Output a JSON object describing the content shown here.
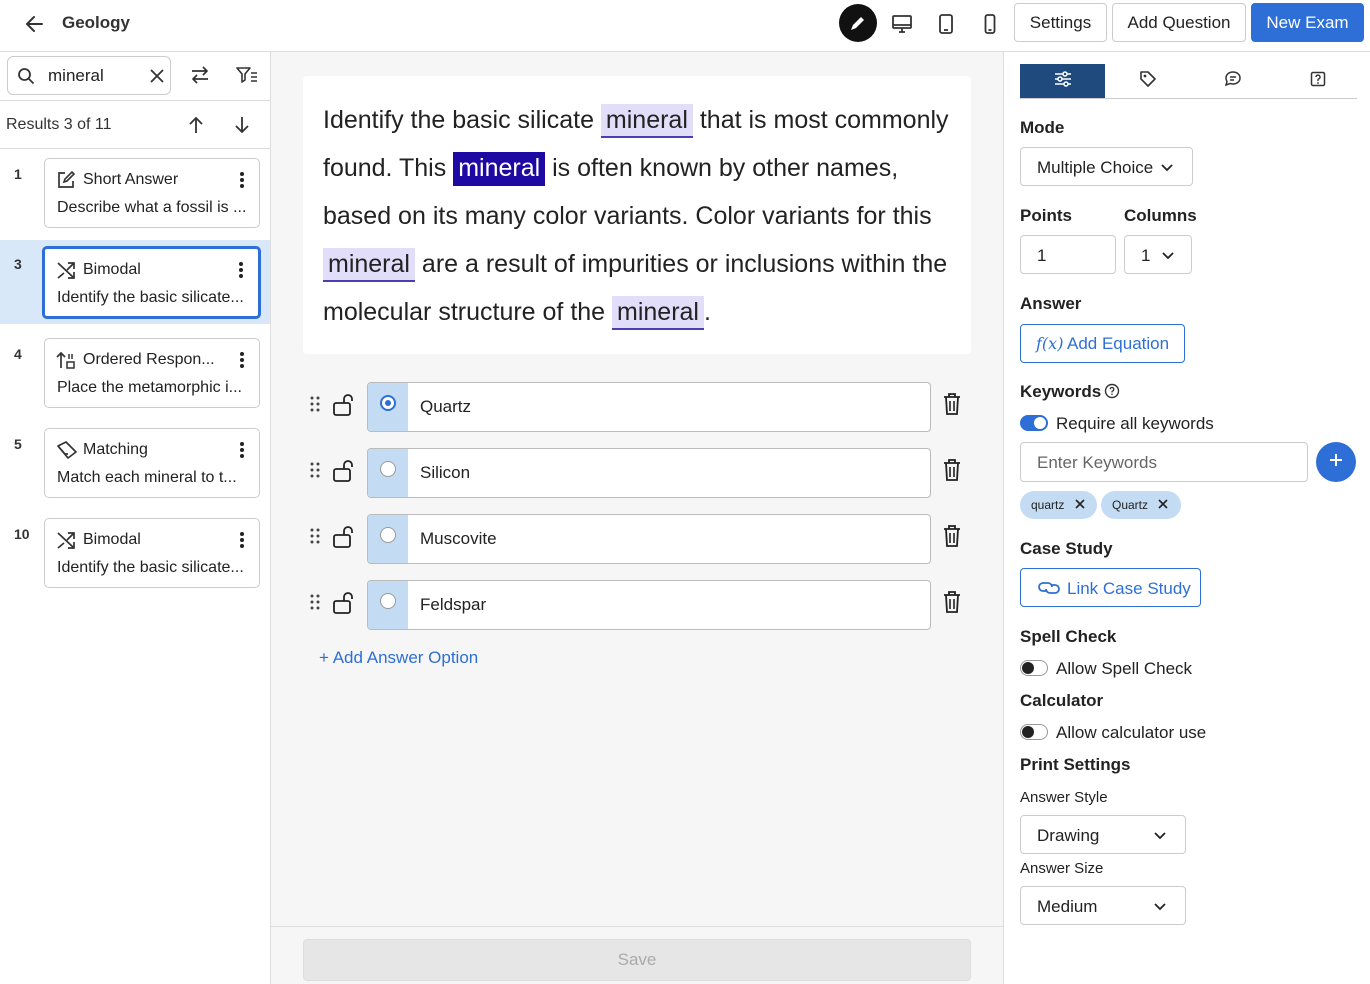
{
  "header": {
    "title": "Geology",
    "buttons": {
      "settings": "Settings",
      "add_question": "Add Question",
      "new_exam": "New Exam"
    }
  },
  "sidebar": {
    "search_value": "mineral",
    "results_text": "Results 3 of 11",
    "items": [
      {
        "num": "1",
        "type": "Short Answer",
        "desc": "Describe what a fossil is ...",
        "icon": "edit-icon",
        "selected": false
      },
      {
        "num": "3",
        "type": "Bimodal",
        "desc": "Identify the basic silicate...",
        "icon": "shuffle-icon",
        "selected": true
      },
      {
        "num": "4",
        "type": "Ordered Respon...",
        "desc": "Place the metamorphic i...",
        "icon": "ordered-icon",
        "selected": false
      },
      {
        "num": "5",
        "type": "Matching",
        "desc": "Match each mineral to t...",
        "icon": "matching-icon",
        "selected": false
      },
      {
        "num": "10",
        "type": "Bimodal",
        "desc": "Identify the basic silicate...",
        "icon": "shuffle-icon",
        "selected": false
      }
    ]
  },
  "question": {
    "segments": [
      {
        "text": "Identify the basic silicate ",
        "hl": ""
      },
      {
        "text": "mineral",
        "hl": "match"
      },
      {
        "text": " that is most commonly found. This ",
        "hl": ""
      },
      {
        "text": "mineral",
        "hl": "current"
      },
      {
        "text": " is often known by other names, based on its many color variants. Color variants for this ",
        "hl": ""
      },
      {
        "text": "mineral",
        "hl": "match"
      },
      {
        "text": " are a result of impurities or inclusions within the molecular structure of the ",
        "hl": ""
      },
      {
        "text": "mineral",
        "hl": "match"
      },
      {
        "text": ".",
        "hl": ""
      }
    ],
    "options": [
      {
        "label": "Quartz",
        "selected": true
      },
      {
        "label": "Silicon",
        "selected": false
      },
      {
        "label": "Muscovite",
        "selected": false
      },
      {
        "label": "Feldspar",
        "selected": false
      }
    ],
    "add_option": "+ Add Answer Option",
    "save": "Save"
  },
  "panel": {
    "mode_label": "Mode",
    "mode_value": "Multiple Choice",
    "points_label": "Points",
    "points_value": "1",
    "columns_label": "Columns",
    "columns_value": "1",
    "answer_label": "Answer",
    "add_equation": "Add Equation",
    "equation_glyph": "f(x)",
    "keywords_label": "Keywords",
    "require_all": "Require all keywords",
    "keywords_placeholder": "Enter Keywords",
    "chips": [
      "quartz",
      "Quartz"
    ],
    "case_study_label": "Case Study",
    "link_case_study": "Link Case Study",
    "spell_check_label": "Spell Check",
    "allow_spell": "Allow Spell Check",
    "calculator_label": "Calculator",
    "allow_calc": "Allow calculator use",
    "print_label": "Print Settings",
    "answer_style_label": "Answer Style",
    "answer_style_value": "Drawing",
    "answer_size_label": "Answer Size",
    "answer_size_value": "Medium"
  },
  "colors": {
    "accent": "#2d6fd6",
    "highlight_current": "#1e0aa3",
    "highlight_match": "#e2defa",
    "selected_row": "#d9e8f8"
  }
}
